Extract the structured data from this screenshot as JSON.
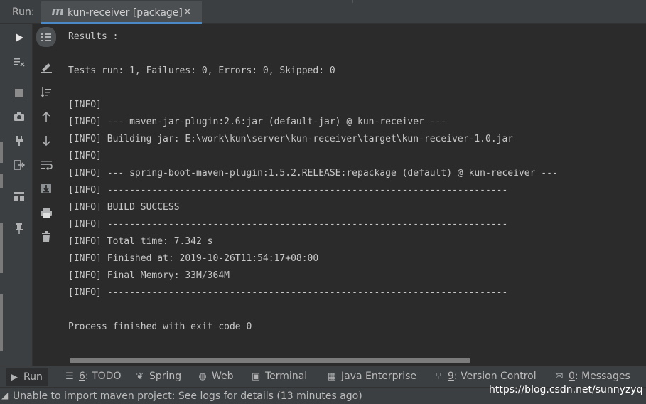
{
  "run_panel": {
    "label": "Run:",
    "tab": {
      "title": "kun-receiver [package]",
      "icon": "maven-m-icon",
      "close_glyph": "✕"
    }
  },
  "console": {
    "lines": [
      "Results :",
      "",
      "Tests run: 1, Failures: 0, Errors: 0, Skipped: 0",
      "",
      "[INFO]",
      "[INFO] --- maven-jar-plugin:2.6:jar (default-jar) @ kun-receiver ---",
      "[INFO] Building jar: E:\\work\\kun\\server\\kun-receiver\\target\\kun-receiver-1.0.jar",
      "[INFO]",
      "[INFO] --- spring-boot-maven-plugin:1.5.2.RELEASE:repackage (default) @ kun-receiver ---",
      "[INFO] ------------------------------------------------------------------------",
      "[INFO] BUILD SUCCESS",
      "[INFO] ------------------------------------------------------------------------",
      "[INFO] Total time: 7.342 s",
      "[INFO] Finished at: 2019-10-26T11:54:17+08:00",
      "[INFO] Final Memory: 33M/364M",
      "[INFO] ------------------------------------------------------------------------",
      "",
      "Process finished with exit code 0"
    ]
  },
  "tool_windows": {
    "run": "Run",
    "todo_num": "6",
    "todo": ": TODO",
    "spring": "Spring",
    "web": "Web",
    "terminal": "Terminal",
    "java_enterprise": "Java Enterprise",
    "vc_num": "9",
    "version_control": ": Version Control",
    "msg_num": "0",
    "messages": ": Messages"
  },
  "status": {
    "message": "Unable to import maven project: See logs for details (13 minutes ago)"
  },
  "watermark": "https://blog.csdn.net/sunnyzyq",
  "colors": {
    "background": "#2b2b2b",
    "panel": "#3c3f41",
    "accent": "#4a88c7"
  }
}
